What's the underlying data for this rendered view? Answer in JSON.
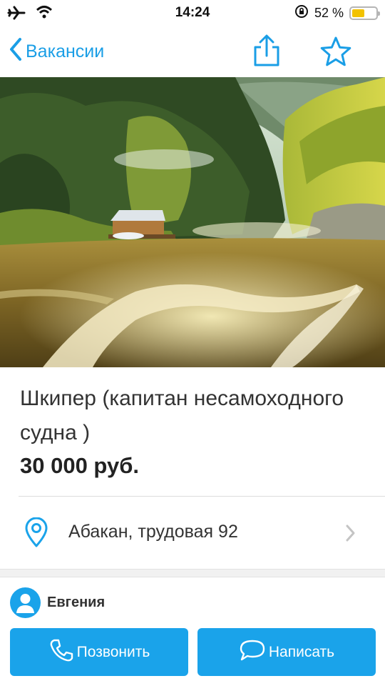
{
  "status_bar": {
    "time": "14:24",
    "battery_text": "52 %",
    "battery_level": 0.52,
    "icons": [
      "airplane-icon",
      "wifi-icon",
      "rotation-lock-icon",
      "battery-icon"
    ]
  },
  "nav": {
    "back_label": "Вакансии",
    "icons": [
      "chevron-left-icon",
      "share-icon",
      "star-icon"
    ],
    "accent_color": "#1a9ee6"
  },
  "listing": {
    "title": "Шкипер (капитан несамоходного судна )",
    "price": "30 000 руб.",
    "location": "Абакан, трудовая 92"
  },
  "contact": {
    "name": "Евгения",
    "call_label": "Позвонить",
    "write_label": "Написать",
    "button_color": "#1aa3ea"
  }
}
